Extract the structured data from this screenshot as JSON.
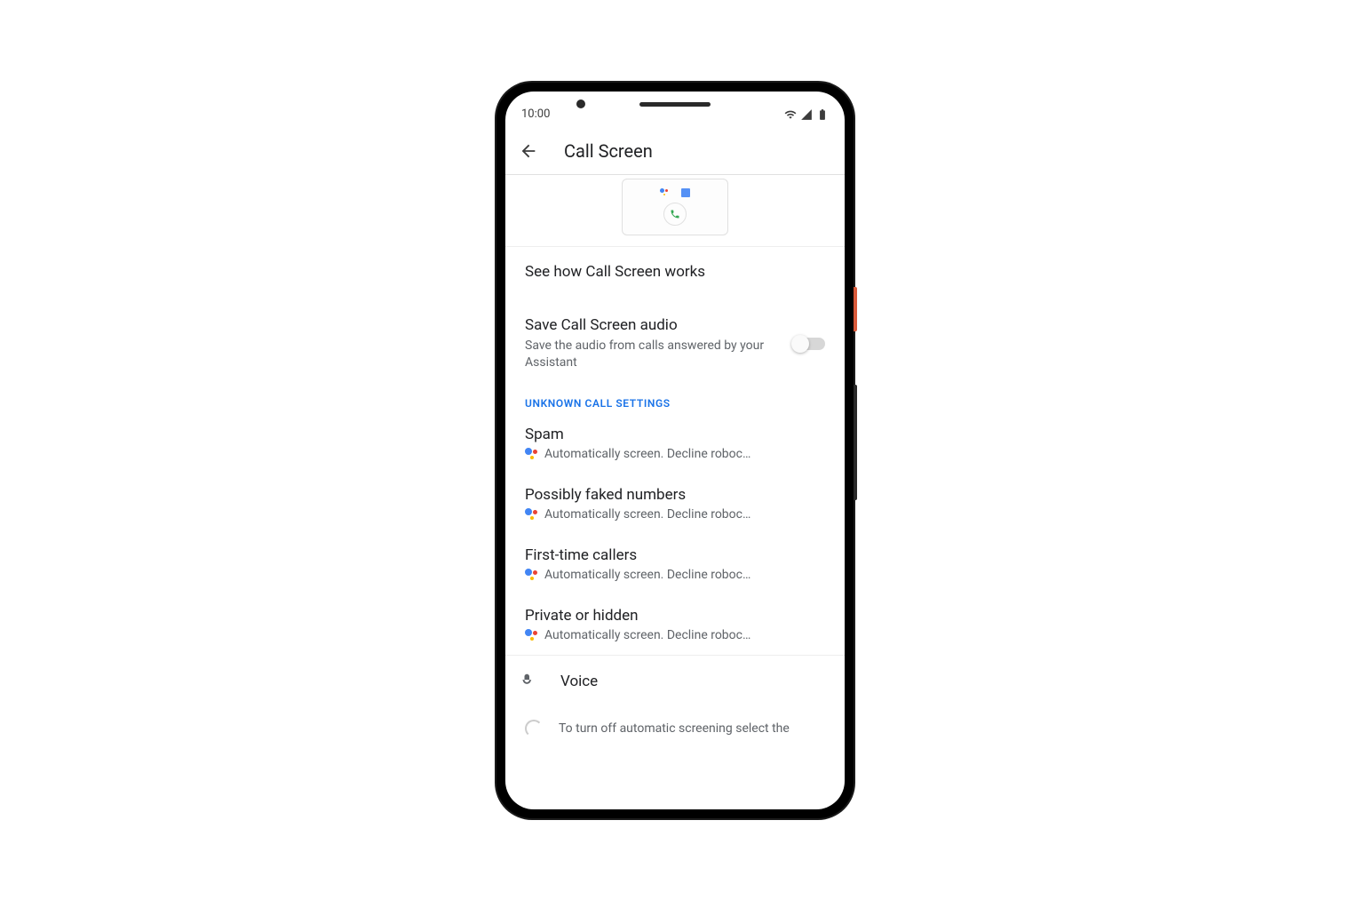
{
  "status_bar": {
    "time": "10:00"
  },
  "header": {
    "title": "Call Screen"
  },
  "demo_link": {
    "label": "See how Call Screen works"
  },
  "save_audio": {
    "title": "Save Call Screen audio",
    "subtitle": "Save the audio from calls answered by your Assistant",
    "enabled": false
  },
  "section_header": "UNKNOWN CALL SETTINGS",
  "settings": [
    {
      "title": "Spam",
      "subtitle": "Automatically screen. Decline roboc…"
    },
    {
      "title": "Possibly faked numbers",
      "subtitle": "Automatically screen. Decline roboc…"
    },
    {
      "title": "First-time callers",
      "subtitle": "Automatically screen. Decline roboc…"
    },
    {
      "title": "Private or hidden",
      "subtitle": "Automatically screen. Decline roboc…"
    }
  ],
  "voice": {
    "label": "Voice"
  },
  "footer_note": "To turn off automatic screening select the"
}
